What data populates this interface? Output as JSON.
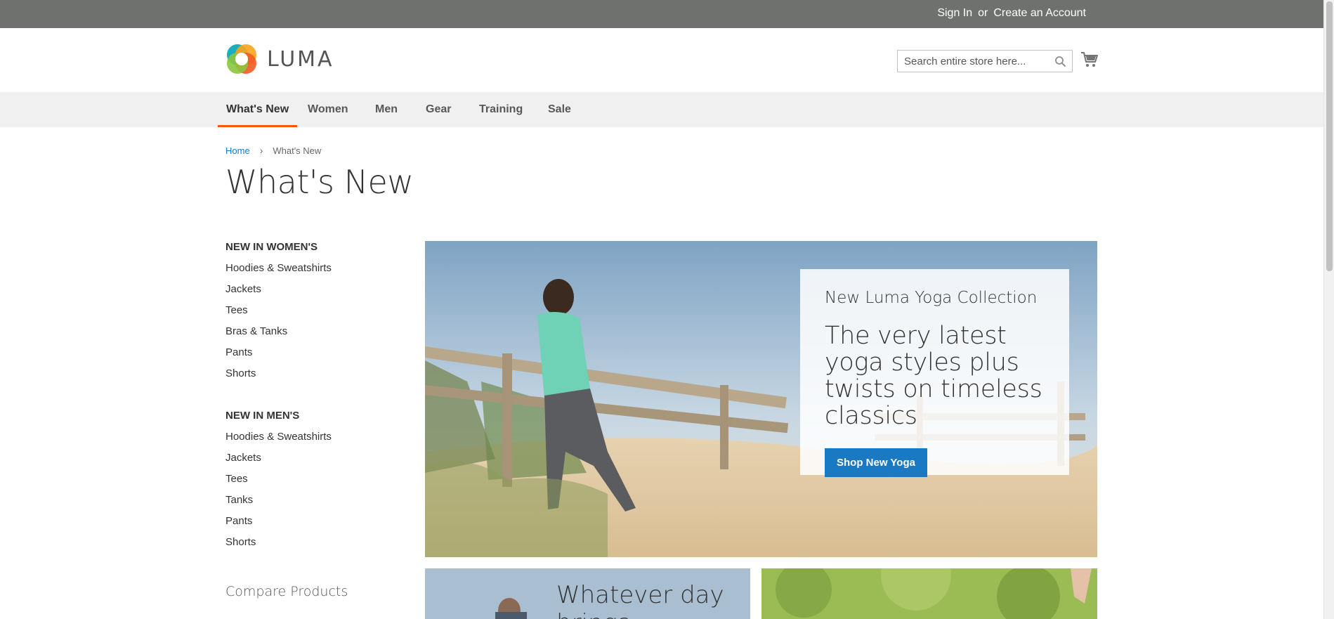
{
  "header": {
    "sign_in": "Sign In",
    "or": "or",
    "create_account": "Create an Account"
  },
  "logo": {
    "text": "LUMA"
  },
  "search": {
    "placeholder": "Search entire store here..."
  },
  "nav": {
    "items": [
      "What's New",
      "Women",
      "Men",
      "Gear",
      "Training",
      "Sale"
    ],
    "active": "What's New"
  },
  "breadcrumb": {
    "home": "Home",
    "current": "What's New"
  },
  "page_title": "What's New",
  "sidebar": {
    "women_heading": "NEW IN WOMEN'S",
    "women_items": [
      "Hoodies & Sweatshirts",
      "Jackets",
      "Tees",
      "Bras & Tanks",
      "Pants",
      "Shorts"
    ],
    "men_heading": "NEW IN MEN'S",
    "men_items": [
      "Hoodies & Sweatshirts",
      "Jackets",
      "Tees",
      "Tanks",
      "Pants",
      "Shorts"
    ],
    "compare_title": "Compare Products"
  },
  "hero": {
    "subtitle": "New Luma Yoga Collection",
    "title": "The very latest yoga styles plus twists on timeless classics",
    "button": "Shop New Yoga"
  },
  "promo_left": {
    "text": "Whatever day brings"
  },
  "colors": {
    "accent": "#ff5501",
    "link": "#1979c3",
    "header_bg": "#6e716e",
    "nav_bg": "#f0f0f0"
  }
}
